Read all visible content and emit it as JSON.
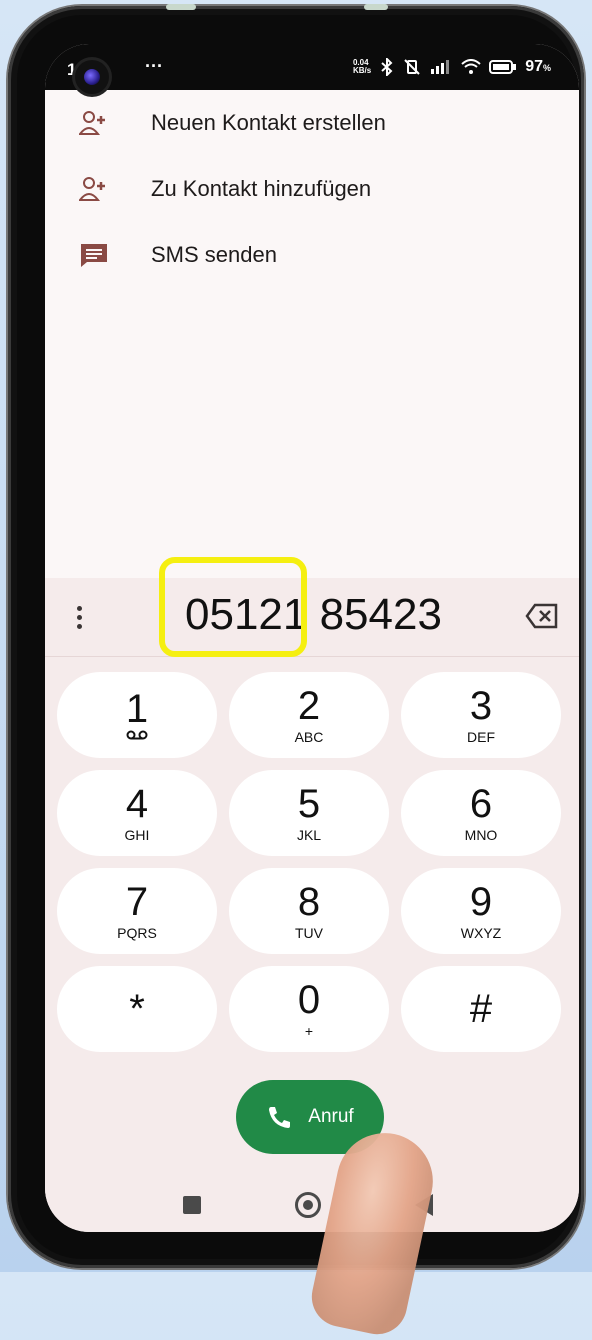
{
  "status_bar": {
    "time": "1",
    "more": "···",
    "net_speed_top": "0.04",
    "net_speed_bottom": "KB/s",
    "battery": "97"
  },
  "menu": {
    "items": [
      {
        "label": "Neuen Kontakt erstellen",
        "icon": "add-person-icon"
      },
      {
        "label": "Zu Kontakt hinzufügen",
        "icon": "add-person-icon"
      },
      {
        "label": "SMS senden",
        "icon": "message-icon"
      }
    ]
  },
  "dialer": {
    "number": "05121 85423",
    "keys": [
      {
        "digit": "1",
        "letters": ""
      },
      {
        "digit": "2",
        "letters": "ABC"
      },
      {
        "digit": "3",
        "letters": "DEF"
      },
      {
        "digit": "4",
        "letters": "GHI"
      },
      {
        "digit": "5",
        "letters": "JKL"
      },
      {
        "digit": "6",
        "letters": "MNO"
      },
      {
        "digit": "7",
        "letters": "PQRS"
      },
      {
        "digit": "8",
        "letters": "TUV"
      },
      {
        "digit": "9",
        "letters": "WXYZ"
      },
      {
        "digit": "*",
        "letters": ""
      },
      {
        "digit": "0",
        "letters": "+"
      },
      {
        "digit": "#",
        "letters": ""
      }
    ],
    "call_label": "Anruf"
  },
  "colors": {
    "call_green": "#218a47",
    "highlight_yellow": "#f5ef10",
    "icon_brown": "#8a4a44",
    "panel_bg": "#f5ebeb"
  }
}
